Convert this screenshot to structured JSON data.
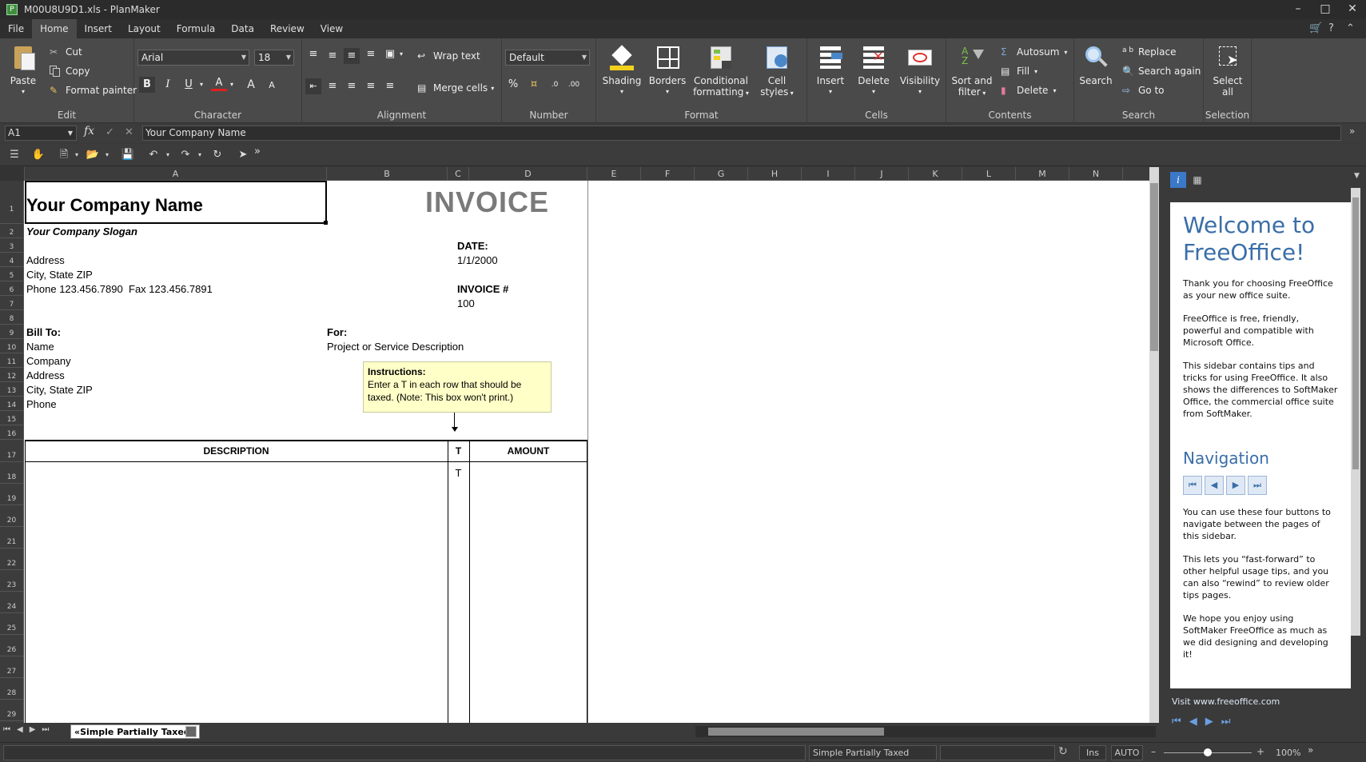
{
  "window": {
    "title": "M00U8U9D1.xls - PlanMaker"
  },
  "menu": [
    "File",
    "Home",
    "Insert",
    "Layout",
    "Formula",
    "Data",
    "Review",
    "View"
  ],
  "ribbon": {
    "edit": {
      "paste": "Paste",
      "cut": "Cut",
      "copy": "Copy",
      "format_painter": "Format painter",
      "label": "Edit"
    },
    "character": {
      "font": "Arial",
      "size": "18",
      "label": "Character"
    },
    "alignment": {
      "wrap": "Wrap text",
      "merge": "Merge cells",
      "label": "Alignment"
    },
    "number": {
      "format": "Default",
      "label": "Number"
    },
    "format": {
      "shading": "Shading",
      "borders": "Borders",
      "conditional1": "Conditional",
      "conditional2": "formatting",
      "cell1": "Cell",
      "cell2": "styles",
      "label": "Format"
    },
    "cells": {
      "insert": "Insert",
      "delete": "Delete",
      "visibility": "Visibility",
      "label": "Cells"
    },
    "contents": {
      "sort1": "Sort and",
      "sort2": "filter",
      "autosum": "Autosum",
      "fill": "Fill",
      "delete": "Delete",
      "label": "Contents"
    },
    "search": {
      "search": "Search",
      "replace": "Replace",
      "search_again": "Search again",
      "goto": "Go to",
      "label": "Search"
    },
    "selection": {
      "select1": "Select",
      "select2": "all",
      "label": "Selection"
    }
  },
  "formula": {
    "cellref": "A1",
    "fx": "fx",
    "value": "Your Company Name"
  },
  "columns": [
    "A",
    "B",
    "C",
    "D",
    "E",
    "F",
    "G",
    "H",
    "I",
    "J",
    "K",
    "L",
    "M",
    "N"
  ],
  "rows": [
    "1",
    "2",
    "3",
    "4",
    "5",
    "6",
    "7",
    "8",
    "9",
    "10",
    "11",
    "12",
    "13",
    "14",
    "15",
    "16",
    "17",
    "18",
    "19",
    "20",
    "21",
    "22",
    "23",
    "24",
    "25",
    "26",
    "27",
    "28",
    "29"
  ],
  "invoice": {
    "company": "Your Company Name",
    "slogan": "Your Company Slogan",
    "heading": "INVOICE",
    "address": "Address",
    "city": "City, State ZIP",
    "phone": "Phone 123.456.7890",
    "fax": "Fax 123.456.7891",
    "date_label": "DATE:",
    "date_value": "1/1/2000",
    "invoice_label": "INVOICE #",
    "invoice_value": "100",
    "billto_label": "Bill To:",
    "billto_name": "Name",
    "billto_company": "Company",
    "billto_address": "Address",
    "billto_city": "City, State ZIP",
    "billto_phone": "Phone",
    "for_label": "For:",
    "for_value": "Project or Service Description",
    "note_title": "Instructions:",
    "note_body1": "Enter a T in each row that should be",
    "note_body2": "taxed.  (Note: This box won't print.)",
    "col_description": "DESCRIPTION",
    "col_t": "T",
    "col_amount": "AMOUNT",
    "row18_t": "T"
  },
  "sheet_tab": "«Simple Partially Taxed»",
  "status": {
    "sheet": "Simple Partially Taxed",
    "ins": "Ins",
    "auto": "AUTO",
    "zoom": "100%"
  },
  "sidebar": {
    "welcome": "Welcome to FreeOffice!",
    "p1": "Thank you for choosing FreeOffice as your new office suite.",
    "p2": "FreeOffice is free, friendly, powerful and compatible with Microsoft Office.",
    "p3": "This sidebar contains tips and tricks for using FreeOffice. It also shows the differences to SoftMaker Office, the commercial office suite from SoftMaker.",
    "nav_title": "Navigation",
    "p4": "You can use these four buttons to navigate between the pages of this sidebar.",
    "p5": "This lets you “fast-forward” to other helpful usage tips, and you can also “rewind” to review older tips pages.",
    "p6": "We hope you enjoy using SoftMaker FreeOffice as much as we did designing and developing it!",
    "link": "Visit www.freeoffice.com"
  }
}
